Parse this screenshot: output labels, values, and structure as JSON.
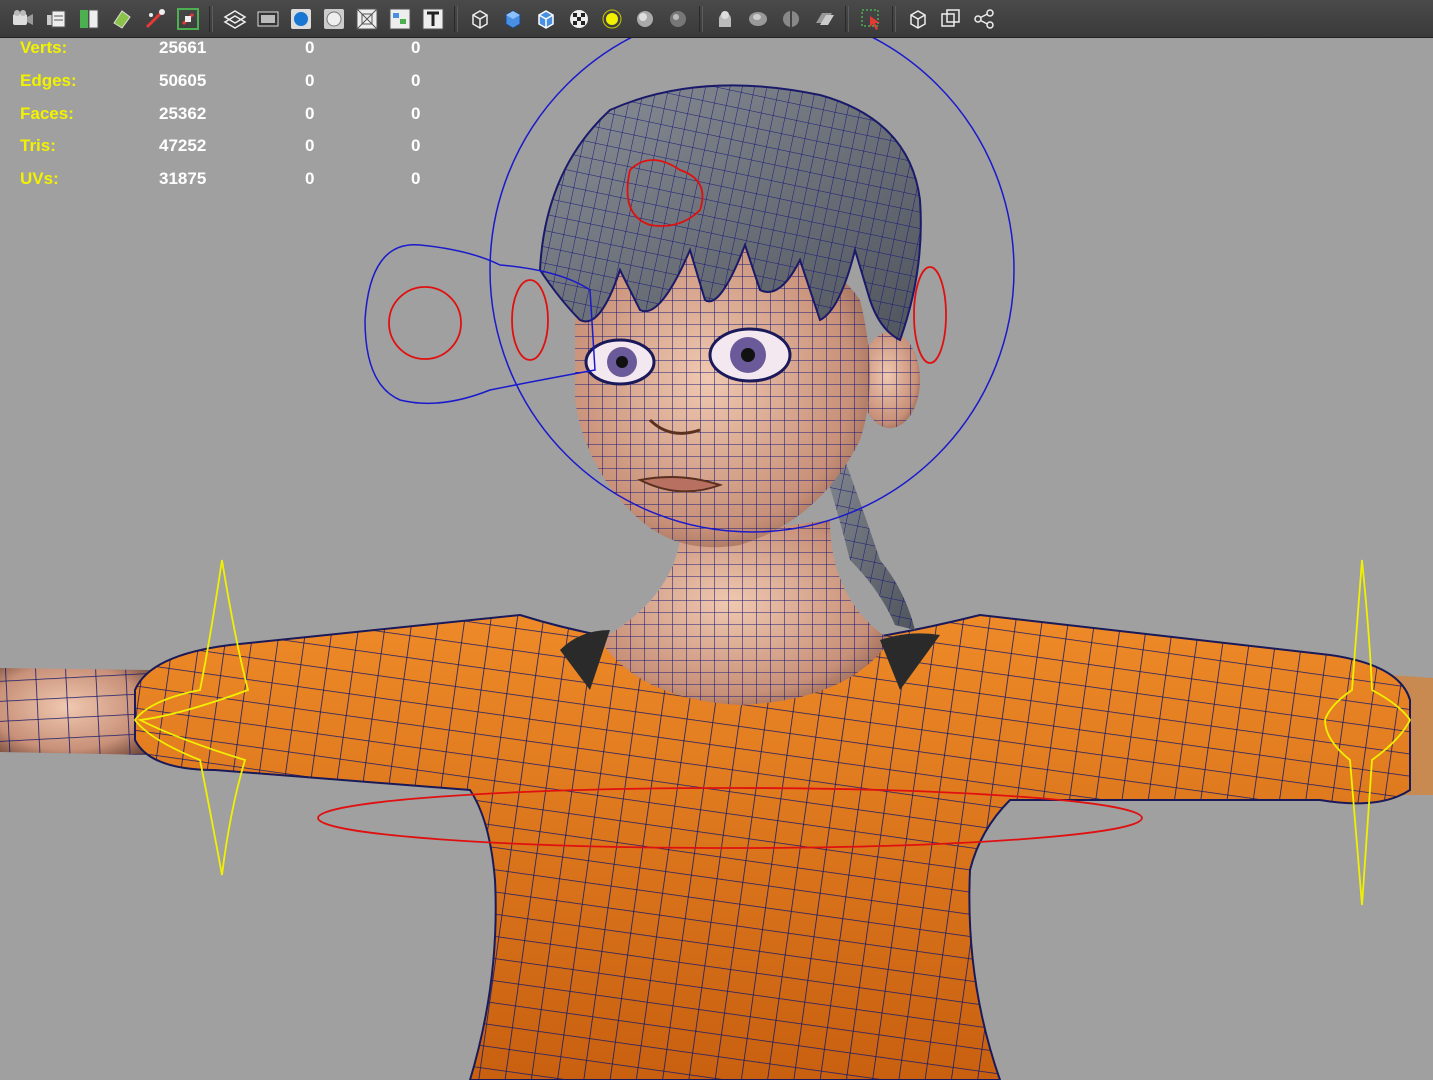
{
  "toolbar": {
    "buttons": [
      {
        "icon": "camera-attributes-icon"
      },
      {
        "icon": "camera-bookmarks-icon"
      },
      {
        "icon": "image-plane-icon"
      },
      {
        "icon": "2d-pan-zoom-icon"
      },
      {
        "icon": "grease-pencil-icon"
      },
      {
        "icon": "grid-toggle-icon"
      },
      {
        "icon": "xray-toggle-icon"
      },
      {
        "icon": "film-gate-icon"
      },
      {
        "icon": "resolution-gate-icon"
      },
      {
        "icon": "gate-mask-icon"
      },
      {
        "icon": "field-chart-icon"
      },
      {
        "icon": "safe-action-icon"
      },
      {
        "icon": "safe-title-icon"
      },
      {
        "icon": "wireframe-icon"
      },
      {
        "icon": "smooth-shade-icon"
      },
      {
        "icon": "wireframe-on-shaded-icon"
      },
      {
        "icon": "textured-icon"
      },
      {
        "icon": "use-all-lights-icon"
      },
      {
        "icon": "shadows-icon"
      },
      {
        "icon": "screen-space-ao-icon"
      },
      {
        "icon": "motion-blur-icon"
      },
      {
        "icon": "anti-aliasing-icon"
      },
      {
        "icon": "depth-of-field-icon"
      },
      {
        "icon": "isolate-select-icon"
      },
      {
        "icon": "xray-joints-icon"
      },
      {
        "icon": "xray-active-components-icon"
      },
      {
        "icon": "symmetry-icon"
      }
    ],
    "accent_yellow": "#f2f200",
    "accent_blue": "#4aa3ff"
  },
  "hud": {
    "rows": [
      {
        "label": "Verts:",
        "v1": "25661",
        "v2": "0",
        "v3": "0"
      },
      {
        "label": "Edges:",
        "v1": "50605",
        "v2": "0",
        "v3": "0"
      },
      {
        "label": "Faces:",
        "v1": "25362",
        "v2": "0",
        "v3": "0"
      },
      {
        "label": "Tris:",
        "v1": "47252",
        "v2": "0",
        "v3": "0"
      },
      {
        "label": "UVs:",
        "v1": "31875",
        "v2": "0",
        "v3": "0"
      }
    ],
    "label_color": "#f2f200",
    "value_color": "#ffffff"
  },
  "viewport": {
    "background": "#a0a0a0",
    "wire_color": "#1a1a7a",
    "control_blue": "#1a1acc",
    "control_red": "#e01010",
    "control_yellow": "#f0f000",
    "shirt_color": "#e07818",
    "skin_color": "#d8a890",
    "hair_color": "#6a6e76"
  }
}
